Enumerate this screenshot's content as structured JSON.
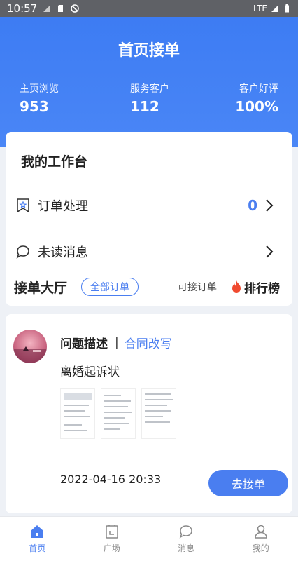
{
  "status_bar": {
    "time": "10:57",
    "network": "LTE"
  },
  "header": {
    "title": "首页接单",
    "stats": [
      {
        "label": "主页浏览",
        "value": "953"
      },
      {
        "label": "服务客户",
        "value": "112"
      },
      {
        "label": "客户好评",
        "value": "100%"
      }
    ]
  },
  "workbench": {
    "title": "我的工作台",
    "orders": {
      "label": "订单处理",
      "count": "0"
    },
    "messages": {
      "label": "未读消息"
    }
  },
  "hall": {
    "title": "接单大厅",
    "tab_all": "全部订单",
    "available": "可接订单",
    "ranking": "排行榜"
  },
  "order": {
    "heading": "问题描述",
    "separator": "|",
    "type": "合同改写",
    "description": "离婚起诉状",
    "time": "2022-04-16 20:33",
    "accept_label": "去接单"
  },
  "tabbar": {
    "items": [
      {
        "label": "首页",
        "icon": "home-icon"
      },
      {
        "label": "广场",
        "icon": "square-icon"
      },
      {
        "label": "消息",
        "icon": "message-icon"
      },
      {
        "label": "我的",
        "icon": "profile-icon"
      }
    ]
  },
  "colors": {
    "primary": "#4a7ef0",
    "ranking_flame": "#f04a2f"
  }
}
